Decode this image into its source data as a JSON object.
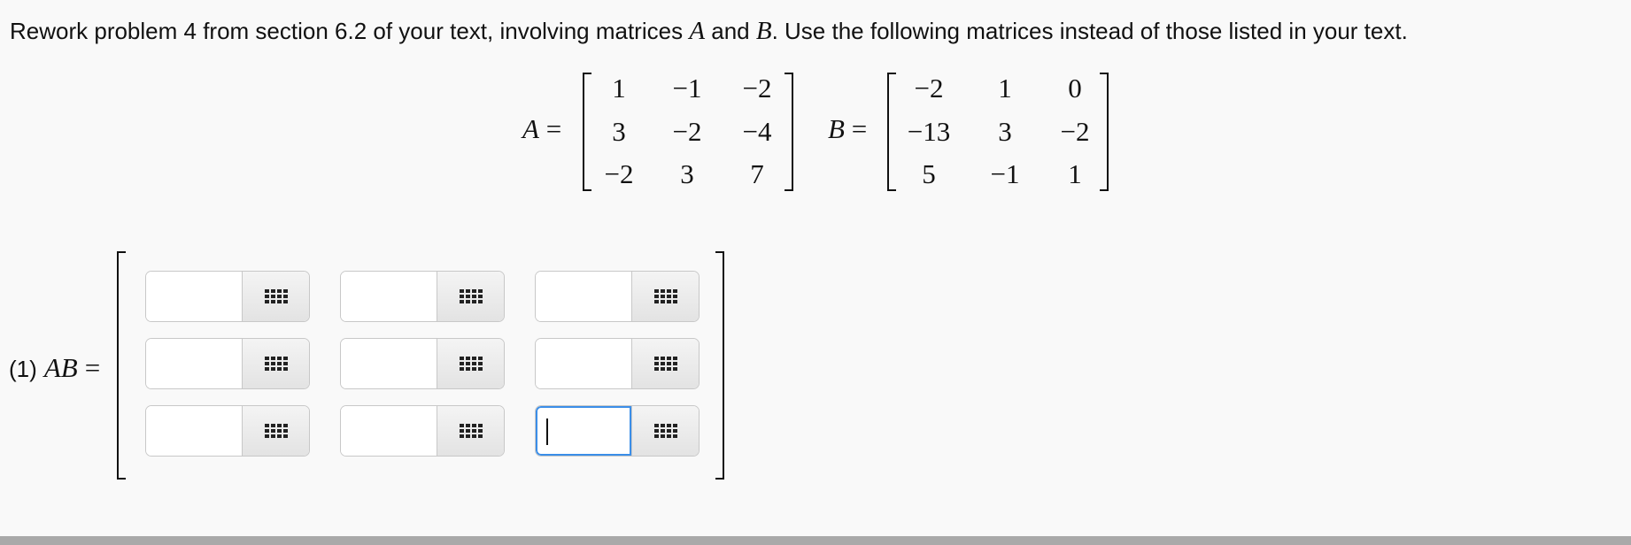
{
  "problem": {
    "intro": "Rework problem 4 from section 6.2 of your text, involving matrices ",
    "var_a": "A",
    "and": " and ",
    "var_b": "B",
    "outro": ". Use the following matrices instead of those listed in your text."
  },
  "matrix_a": {
    "name": "A",
    "equals": "=",
    "rows": [
      [
        "1",
        "−1",
        "−2"
      ],
      [
        "3",
        "−2",
        "−4"
      ],
      [
        "−2",
        "3",
        "7"
      ]
    ]
  },
  "matrix_b": {
    "name": "B",
    "equals": "=",
    "rows": [
      [
        "−2",
        "1",
        "0"
      ],
      [
        "−13",
        "3",
        "−2"
      ],
      [
        "5",
        "−1",
        "1"
      ]
    ]
  },
  "answer": {
    "number": "(1)",
    "name": "AB",
    "equals": "=",
    "cells": [
      [
        "",
        "",
        ""
      ],
      [
        "",
        "",
        ""
      ],
      [
        "",
        "",
        ""
      ]
    ],
    "focused_cell": "row 3, column 3"
  },
  "icons": {
    "palette": "grid-palette-icon"
  }
}
